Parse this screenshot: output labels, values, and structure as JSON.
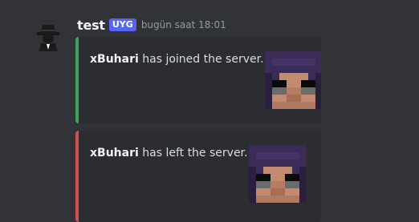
{
  "message": {
    "username": "test",
    "badge": "UYG",
    "timestamp": "bugün saat 18:01",
    "avatar_icon": "spy-silhouette-icon"
  },
  "embeds": [
    {
      "player": "xBuhari",
      "text": " has joined the server.",
      "bar_color": "#3ba55c",
      "thumbnail_icon": "minecraft-skin-face-icon"
    },
    {
      "player": "xBuhari",
      "text": " has left the server.",
      "bar_color": "#d25050",
      "thumbnail_icon": "minecraft-skin-face-icon"
    }
  ],
  "colors": {
    "background": "#313338",
    "embed_background": "#2b2d31",
    "badge": "#5865f2"
  }
}
